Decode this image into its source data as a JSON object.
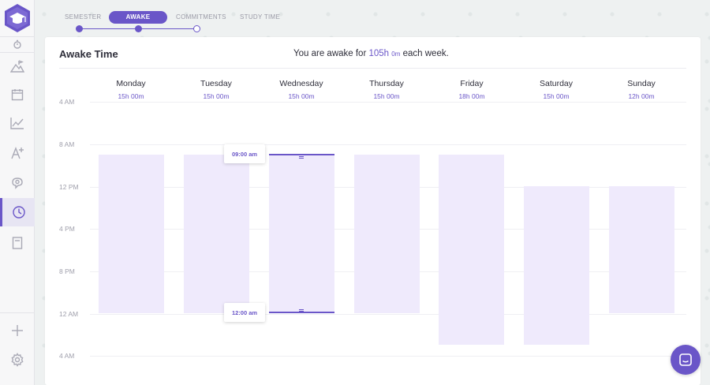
{
  "colors": {
    "accent": "#6a56c8",
    "bar": "#efeafc"
  },
  "stepper": {
    "steps": [
      {
        "label": "SEMESTER",
        "state": "done"
      },
      {
        "label": "AWAKE",
        "state": "active"
      },
      {
        "label": "COMMITMENTS",
        "state": "next"
      },
      {
        "label": "STUDY TIME",
        "state": "pending"
      }
    ]
  },
  "sidebar": {
    "items": [
      {
        "icon": "timer-icon"
      },
      {
        "icon": "mountain-icon"
      },
      {
        "icon": "calendar-icon"
      },
      {
        "icon": "chart-icon"
      },
      {
        "icon": "grade-icon"
      },
      {
        "icon": "brain-icon"
      },
      {
        "icon": "clock-icon",
        "active": true
      },
      {
        "icon": "book-icon"
      },
      {
        "icon": "plus-icon"
      },
      {
        "icon": "gear-icon"
      }
    ]
  },
  "card": {
    "title": "Awake Time",
    "summary_prefix": "You are awake for",
    "summary_hours": "105h",
    "summary_minutes": "0m",
    "summary_suffix": "each week."
  },
  "hours": [
    "4 AM",
    "8 AM",
    "12 PM",
    "4 PM",
    "8 PM",
    "12 AM",
    "4 AM"
  ],
  "days": [
    {
      "name": "Monday",
      "total": "15h 00m",
      "awake_fraction": 0.625
    },
    {
      "name": "Tuesday",
      "total": "15h 00m",
      "awake_fraction": 0.625
    },
    {
      "name": "Wednesday",
      "total": "15h 00m",
      "awake_fraction": 0.625
    },
    {
      "name": "Thursday",
      "total": "15h 00m",
      "awake_fraction": 0.625
    },
    {
      "name": "Friday",
      "total": "18h 00m",
      "awake_fraction": 0.75
    },
    {
      "name": "Saturday",
      "total": "15h 00m",
      "awake_fraction": 0.625
    },
    {
      "name": "Sunday",
      "total": "12h 00m",
      "awake_fraction": 0.5
    }
  ],
  "tooltips": {
    "start": "09:00 am",
    "end": "12:00 am"
  }
}
